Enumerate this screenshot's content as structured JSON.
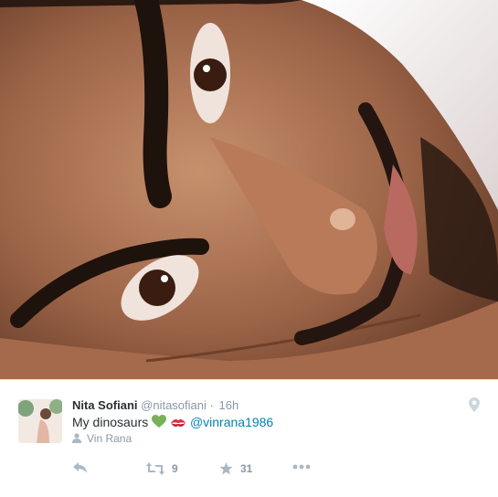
{
  "tweet": {
    "name": "Nita Sofiani",
    "handle": "@nitasofiani",
    "separator": "·",
    "time": "16h",
    "text": "My dinosaurs",
    "mention": "@vinrana1986",
    "tagged_user": "Vin Rana",
    "retweet_count": "9",
    "favorite_count": "31"
  },
  "icons": {
    "location": "location-pin-icon",
    "tag": "person-icon",
    "reply": "reply-icon",
    "retweet": "retweet-icon",
    "favorite": "star-icon",
    "more": "more-dots-icon",
    "emoji1": "green-heart-emoji",
    "emoji2": "kiss-mark-emoji"
  },
  "colors": {
    "link": "#0084b4",
    "muted": "#8899a6",
    "text": "#292f33"
  }
}
